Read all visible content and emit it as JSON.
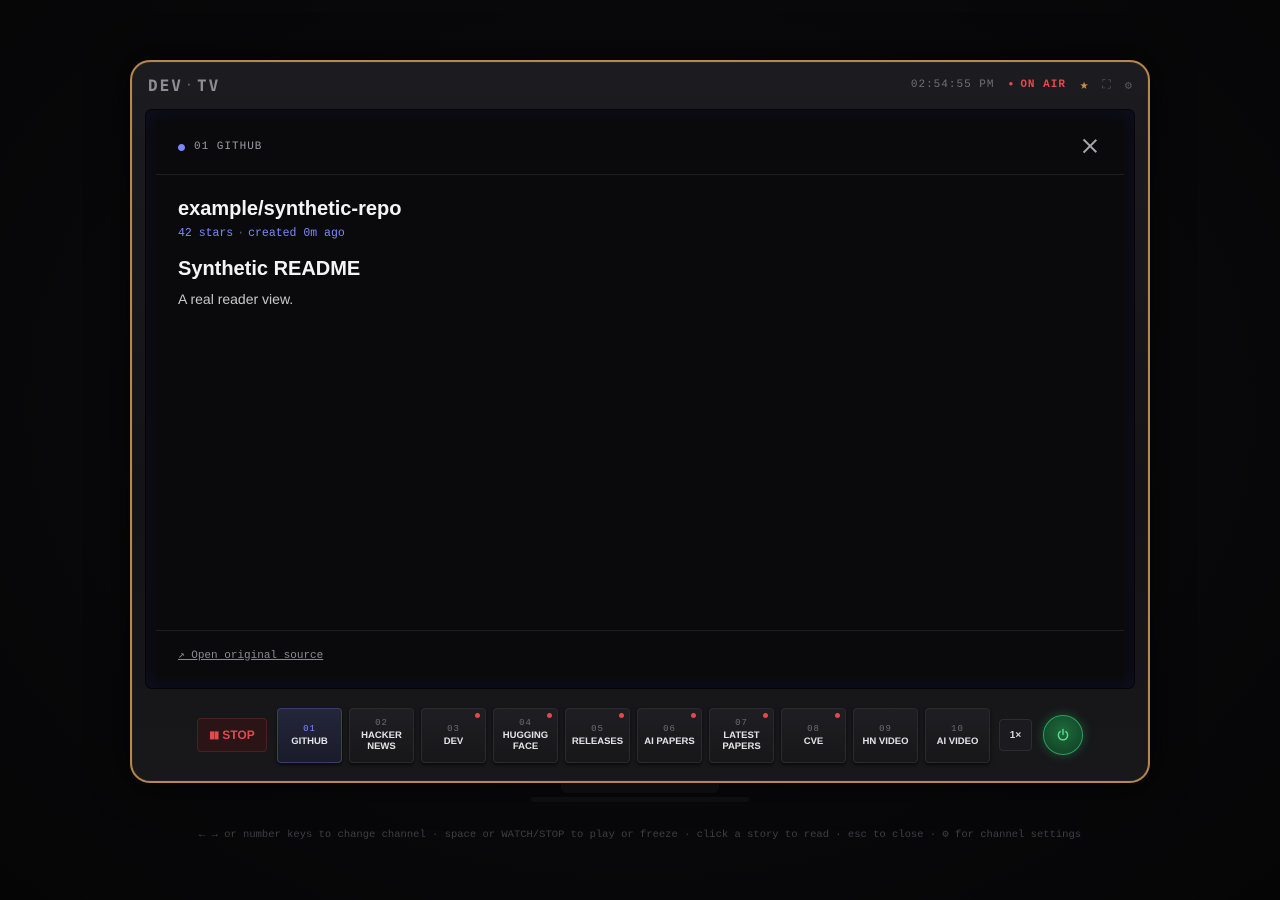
{
  "brand": {
    "left": "DEV",
    "sep": "·",
    "right": "TV"
  },
  "status": {
    "clock": "02:54:55 PM",
    "on_air": "ON AIR"
  },
  "colors": {
    "accent": "#7b87ff",
    "live": "#e5484d",
    "frame": "#b8874a",
    "power": "#2aa35a"
  },
  "icons": {
    "star": "star-icon",
    "fullscreen": "fullscreen-icon",
    "settings": "gear-icon"
  },
  "reader": {
    "channel_label": "01 GITHUB",
    "repo_title": "example/synthetic-repo",
    "stars": "42 stars",
    "meta_sep": "·",
    "created": "created 0m ago",
    "readme_heading": "Synthetic README",
    "readme_text": "A real reader view.",
    "source_link": "↗ Open original source"
  },
  "controls": {
    "stop_label": "STOP",
    "speed_label": "1×",
    "channels": [
      {
        "num": "01",
        "line1": "GITHUB",
        "line2": "",
        "active": true,
        "badge": false
      },
      {
        "num": "02",
        "line1": "HACKER",
        "line2": "NEWS",
        "active": false,
        "badge": false
      },
      {
        "num": "03",
        "line1": "DEV",
        "line2": "",
        "active": false,
        "badge": true
      },
      {
        "num": "04",
        "line1": "HUGGING",
        "line2": "FACE",
        "active": false,
        "badge": true
      },
      {
        "num": "05",
        "line1": "RELEASES",
        "line2": "",
        "active": false,
        "badge": true
      },
      {
        "num": "06",
        "line1": "AI PAPERS",
        "line2": "",
        "active": false,
        "badge": true
      },
      {
        "num": "07",
        "line1": "LATEST",
        "line2": "PAPERS",
        "active": false,
        "badge": true
      },
      {
        "num": "08",
        "line1": "CVE",
        "line2": "",
        "active": false,
        "badge": true
      },
      {
        "num": "09",
        "line1": "HN VIDEO",
        "line2": "",
        "active": false,
        "badge": false
      },
      {
        "num": "10",
        "line1": "AI VIDEO",
        "line2": "",
        "active": false,
        "badge": false
      }
    ]
  },
  "hint": "← → or number keys to change channel · space or WATCH/STOP to play or freeze · click a story to read · esc to close · ⚙ for channel settings"
}
